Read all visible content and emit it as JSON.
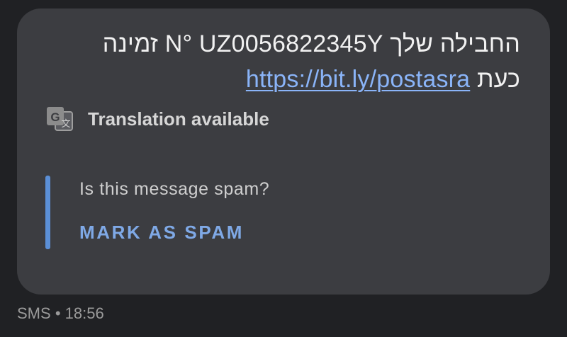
{
  "message": {
    "line1": "החבילה שלך N° UZ0056822345Y זמינה",
    "line2_text": "כעת",
    "link_text": "https://bit.ly/postasra"
  },
  "translation": {
    "icon": "google-translate-icon",
    "label": "Translation available"
  },
  "spam_prompt": {
    "question": "Is this message spam?",
    "action_label": "MARK AS SPAM"
  },
  "meta": {
    "channel": "SMS",
    "separator": "•",
    "time": "18:56"
  },
  "colors": {
    "background": "#202124",
    "bubble": "#3c3d41",
    "link": "#8ab4f8",
    "accent_bar": "#5b8fd6",
    "action": "#7fa9e6"
  }
}
